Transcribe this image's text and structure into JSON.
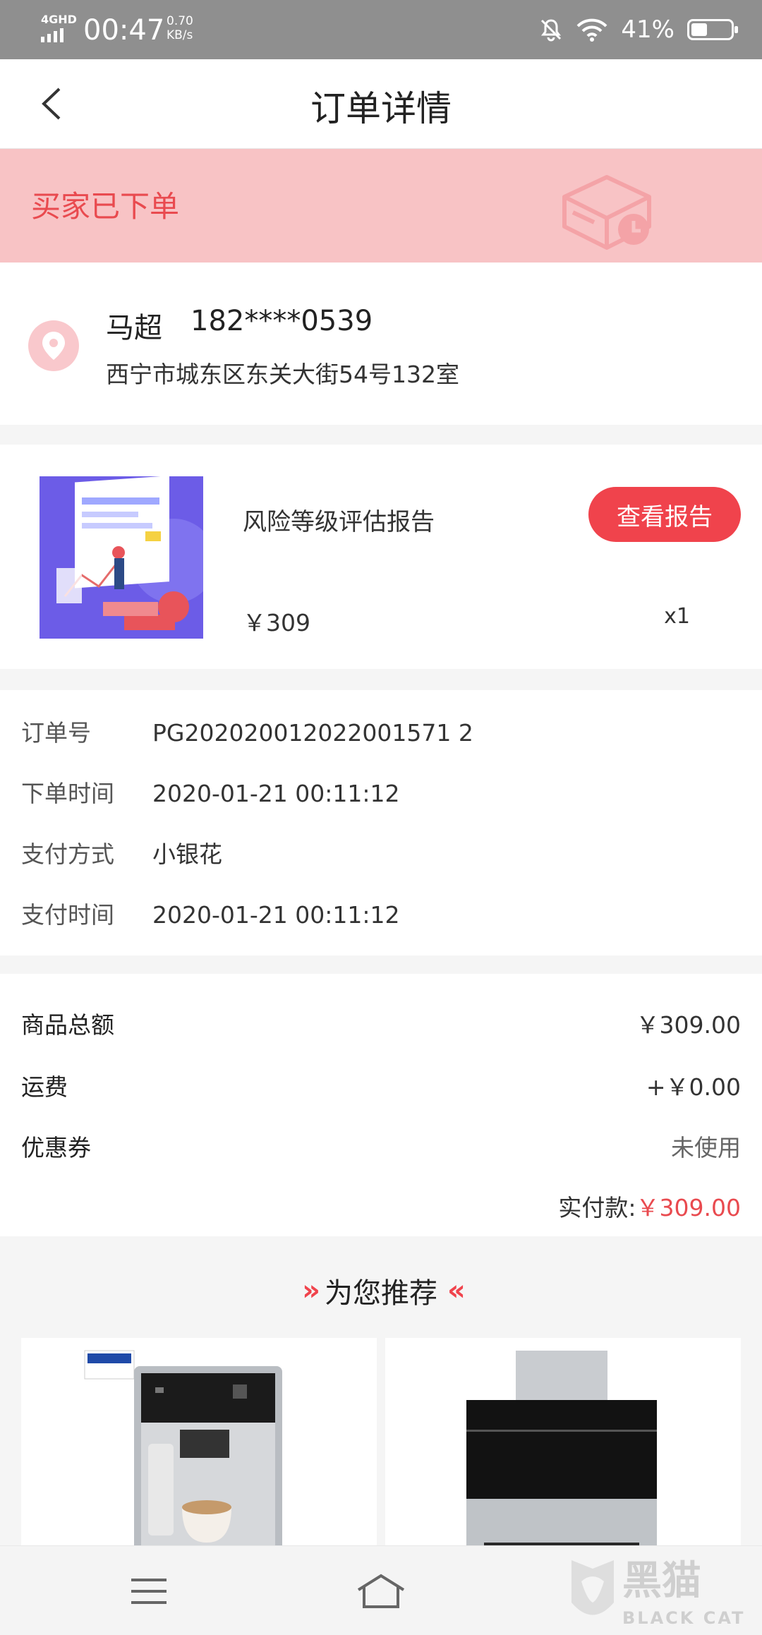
{
  "status_bar": {
    "network": "4GHD",
    "time": "00:47",
    "speed_value": "0.70",
    "speed_unit": "KB/s",
    "battery_percent": "41%",
    "battery_level": 0.41
  },
  "header": {
    "title": "订单详情"
  },
  "order_status": {
    "text": "买家已下单"
  },
  "address": {
    "name": "马超",
    "phone": "182****0539",
    "detail": "西宁市城东区东关大街54号132室"
  },
  "product": {
    "name": "风险等级评估报告",
    "button_label": "查看报告",
    "price": "￥309",
    "quantity": "x1"
  },
  "order_info": [
    {
      "label": "订单号",
      "value": "PG202020012022001571 2"
    },
    {
      "label": "下单时间",
      "value": "2020-01-21 00:11:12"
    },
    {
      "label": "支付方式",
      "value": "小银花"
    },
    {
      "label": "支付时间",
      "value": "2020-01-21 00:11:12"
    }
  ],
  "totals": {
    "goods_label": "商品总额",
    "goods_value": "￥309.00",
    "shipping_label": "运费",
    "shipping_value": "+￥0.00",
    "coupon_label": "优惠券",
    "coupon_value": "未使用",
    "paid_label": "实付款:",
    "paid_value": "￥309.00"
  },
  "recommend": {
    "title": "为您推荐"
  },
  "watermark": {
    "cn": "黑猫",
    "en": "BLACK CAT"
  }
}
